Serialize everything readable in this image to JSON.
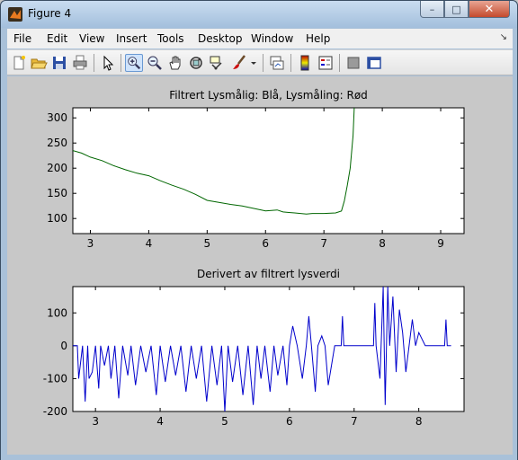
{
  "window": {
    "title": "Figure 4"
  },
  "window_buttons": {
    "minimize": "–",
    "maximize": "□",
    "close": "✕"
  },
  "menu": {
    "items": [
      "File",
      "Edit",
      "View",
      "Insert",
      "Tools",
      "Desktop",
      "Window",
      "Help"
    ]
  },
  "toolbar": {
    "icons": [
      "new-figure-icon",
      "open-file-icon",
      "save-icon",
      "print-icon",
      "edit-plot-arrow-icon",
      "zoom-in-icon",
      "zoom-out-icon",
      "pan-hand-icon",
      "rotate-3d-icon",
      "data-cursor-icon",
      "brush-icon",
      "link-plot-icon",
      "colorbar-icon",
      "legend-icon",
      "hide-plot-tools-icon",
      "show-plot-tools-icon"
    ],
    "active_tool": "zoom-in-icon"
  },
  "colors": {
    "series_filtered": "#0000ff",
    "series_raw": "#ff0000",
    "series_overlay": "#006600",
    "derivative": "#0000cc",
    "figure_bg": "#c8c8c8"
  },
  "chart_data": [
    {
      "type": "line",
      "title": "Filtrert Lysmålig: Blå, Lysmåling: Rød",
      "xlabel": "",
      "ylabel": "",
      "xlim": [
        2.7,
        9.4
      ],
      "ylim": [
        70,
        320
      ],
      "xticks": [
        3,
        4,
        5,
        6,
        7,
        8,
        9
      ],
      "yticks": [
        100,
        150,
        200,
        250,
        300
      ],
      "grid": false,
      "series": [
        {
          "color": "#006600",
          "x": [
            2.7,
            2.85,
            3.0,
            3.2,
            3.4,
            3.6,
            3.8,
            4.0,
            4.2,
            4.4,
            4.6,
            4.8,
            5.0,
            5.2,
            5.4,
            5.6,
            5.8,
            6.0,
            6.2,
            6.3,
            6.4,
            6.5,
            6.6,
            6.7,
            6.8,
            7.0,
            7.2,
            7.3,
            7.35,
            7.4,
            7.45,
            7.5,
            7.52
          ],
          "y": [
            235,
            230,
            222,
            215,
            205,
            197,
            190,
            185,
            175,
            166,
            158,
            148,
            136,
            132,
            128,
            125,
            120,
            115,
            117,
            113,
            112,
            111,
            110,
            109,
            110,
            110,
            111,
            115,
            135,
            165,
            200,
            265,
            320
          ]
        }
      ]
    },
    {
      "type": "line",
      "title": "Derivert av filtrert lysverdi",
      "xlabel": "",
      "ylabel": "",
      "xlim": [
        2.65,
        8.7
      ],
      "ylim": [
        -200,
        180
      ],
      "xticks": [
        3,
        4,
        5,
        6,
        7,
        8
      ],
      "yticks": [
        -200,
        -100,
        0,
        100
      ],
      "grid": false,
      "series": [
        {
          "color": "#0000cc",
          "x": [
            2.65,
            2.72,
            2.74,
            2.8,
            2.84,
            2.88,
            2.9,
            2.95,
            3.0,
            3.05,
            3.08,
            3.14,
            3.2,
            3.24,
            3.3,
            3.36,
            3.42,
            3.5,
            3.55,
            3.62,
            3.7,
            3.78,
            3.86,
            3.94,
            4.0,
            4.08,
            4.16,
            4.24,
            4.32,
            4.4,
            4.48,
            4.56,
            4.64,
            4.72,
            4.8,
            4.88,
            4.95,
            5.0,
            5.05,
            5.12,
            5.2,
            5.28,
            5.36,
            5.44,
            5.5,
            5.56,
            5.62,
            5.7,
            5.76,
            5.82,
            5.9,
            5.96,
            6.0,
            6.05,
            6.12,
            6.2,
            6.26,
            6.3,
            6.34,
            6.4,
            6.44,
            6.5,
            6.55,
            6.6,
            6.7,
            6.8,
            6.82,
            6.84,
            7.0,
            7.2,
            7.3,
            7.32,
            7.34,
            7.4,
            7.45,
            7.48,
            7.52,
            7.55,
            7.6,
            7.65,
            7.7,
            7.75,
            7.8,
            7.85,
            7.9,
            7.95,
            8.0,
            8.1,
            8.2,
            8.3,
            8.4,
            8.42,
            8.44,
            8.5
          ],
          "y": [
            0,
            0,
            -100,
            0,
            -170,
            0,
            -100,
            -80,
            0,
            -130,
            0,
            -60,
            0,
            -100,
            0,
            -160,
            0,
            -90,
            0,
            -120,
            0,
            -80,
            0,
            -150,
            0,
            -110,
            0,
            -90,
            0,
            -140,
            0,
            -100,
            0,
            -170,
            0,
            -120,
            0,
            -200,
            0,
            -110,
            0,
            -150,
            0,
            -180,
            0,
            -100,
            0,
            -140,
            0,
            -90,
            0,
            -120,
            0,
            60,
            0,
            -100,
            0,
            90,
            0,
            -140,
            0,
            30,
            0,
            -120,
            0,
            0,
            90,
            0,
            0,
            0,
            0,
            130,
            0,
            -100,
            180,
            -180,
            180,
            0,
            150,
            -80,
            110,
            40,
            -80,
            0,
            80,
            0,
            40,
            0,
            0,
            0,
            0,
            80,
            0,
            0
          ]
        }
      ]
    }
  ]
}
